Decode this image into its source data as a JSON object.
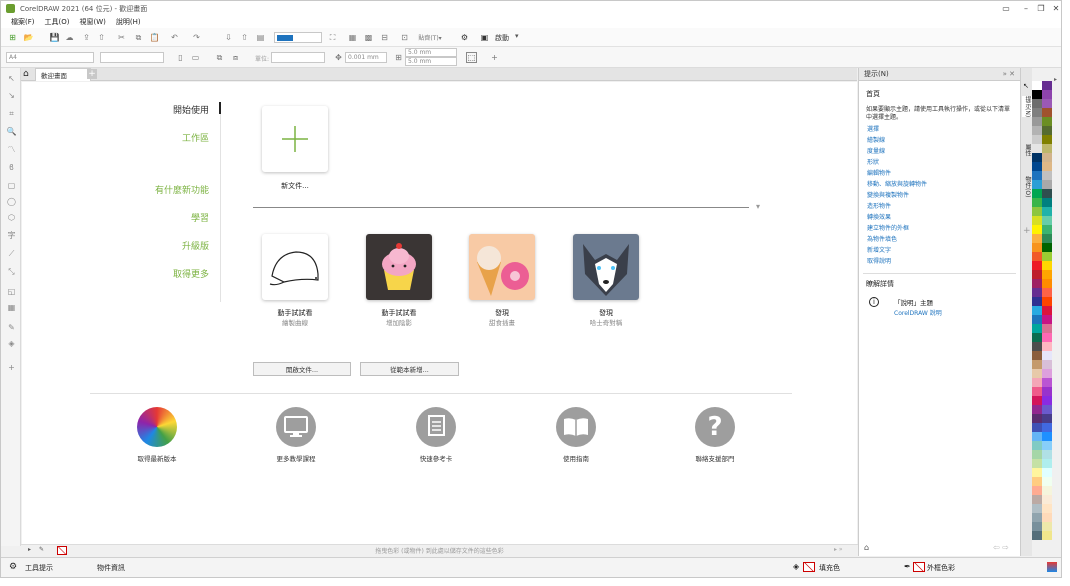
{
  "window": {
    "title": "CorelDRAW 2021 (64 位元) - 歡迎畫面"
  },
  "menu": [
    "檔案(F)",
    "工具(O)",
    "視窗(W)",
    "說明(H)"
  ],
  "toolbar": {
    "launch_label": "啟動",
    "dimension1": "5.0 mm",
    "dimension2": "5.0 mm",
    "nudge": "0.001 mm",
    "page_size": "A4",
    "units_label": "單位:"
  },
  "tab": {
    "label": "歡迎畫面"
  },
  "welcome": {
    "nav": [
      {
        "label": "開始使用",
        "active": true
      },
      {
        "label": "工作區",
        "active": false
      },
      {
        "label": "有什麼新功能",
        "active": false
      },
      {
        "label": "學習",
        "active": false
      },
      {
        "label": "升級版",
        "active": false
      },
      {
        "label": "取得更多",
        "active": false
      }
    ],
    "new_doc_label": "新文件...",
    "cards": [
      {
        "title": "動手試試看",
        "sub": "繪製曲線"
      },
      {
        "title": "動手試試看",
        "sub": "增加陰影"
      },
      {
        "title": "發現",
        "sub": "甜食插畫"
      },
      {
        "title": "發現",
        "sub": "哈士奇對稱"
      }
    ],
    "open_doc_btn": "開啟文件...",
    "new_template_btn": "從範本新增...",
    "links": [
      {
        "label": "取得最新版本",
        "icon": "colorful-artwork-icon"
      },
      {
        "label": "更多教學課程",
        "icon": "monitor-icon"
      },
      {
        "label": "快速參考卡",
        "icon": "document-icon"
      },
      {
        "label": "使用指南",
        "icon": "book-icon"
      },
      {
        "label": "聯絡支援部門",
        "icon": "question-icon"
      }
    ]
  },
  "status": {
    "drop_hint": "拖曳色彩 (或物件) 到此處以儲存文件的這些色彩"
  },
  "bottom": {
    "tool_hints": "工具提示",
    "object_info": "物件資訊",
    "fill": "填充色",
    "outline": "外框色彩"
  },
  "hints_docker": {
    "header": "提示(N)",
    "title": "首頁",
    "desc": "如果要顯示主題，請使用工具執行操作，或從以下清單中選擇主題。",
    "topics": [
      "選擇",
      "繪製線",
      "度量線",
      "形狀",
      "編輯物件",
      "移動、縮放與旋轉物件",
      "變換與複製物件",
      "造形物件",
      "轉換效果",
      "建立物件的外框",
      "為物件填色",
      "新增文字",
      "取得說明"
    ],
    "learn_more": "瞭解詳情",
    "help_title": "「說明」主題",
    "help_link": "CorelDRAW 說明"
  },
  "side_tabs": [
    "提示(N)",
    "屬性",
    "物件(O)"
  ],
  "colors": {
    "accent": "#7cb342",
    "link": "#1e73be",
    "icon_gray": "#9e9e9e"
  }
}
